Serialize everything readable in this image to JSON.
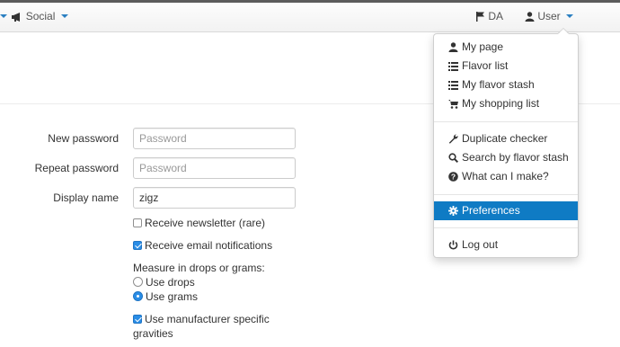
{
  "navbar": {
    "social_label": "Social",
    "language_label": "DA",
    "user_label": "User",
    "icons": {
      "social": "megaphone-icon",
      "language": "flag-icon",
      "user": "user-icon"
    }
  },
  "form": {
    "new_password": {
      "label": "New password",
      "value": "",
      "placeholder": "Password"
    },
    "repeat_password": {
      "label": "Repeat password",
      "value": "",
      "placeholder": "Password"
    },
    "display_name": {
      "label": "Display name",
      "value": "zigz",
      "placeholder": ""
    },
    "newsletter": {
      "label": "Receive newsletter (rare)",
      "checked": false
    },
    "email_notifications": {
      "label": "Receive email notifications",
      "checked": true
    },
    "measure": {
      "label": "Measure in drops or grams:",
      "options": [
        {
          "label": "Use drops",
          "selected": false
        },
        {
          "label": "Use grams",
          "selected": true
        }
      ]
    },
    "manufacturer_gravities": {
      "label_line1": "Use manufacturer specific",
      "label_line2": "gravities",
      "checked": true
    }
  },
  "user_menu": {
    "groups": [
      [
        {
          "label": "My page",
          "icon": "user-icon"
        },
        {
          "label": "Flavor list",
          "icon": "list-icon"
        },
        {
          "label": "My flavor stash",
          "icon": "list-icon"
        },
        {
          "label": "My shopping list",
          "icon": "shopping-cart-icon"
        }
      ],
      [
        {
          "label": "Duplicate checker",
          "icon": "wrench-icon"
        },
        {
          "label": "Search by flavor stash",
          "icon": "search-icon"
        },
        {
          "label": "What can I make?",
          "icon": "question-icon"
        }
      ],
      [
        {
          "label": "Preferences",
          "icon": "gear-icon",
          "active": true
        }
      ],
      [
        {
          "label": "Log out",
          "icon": "power-icon"
        }
      ]
    ]
  },
  "colors": {
    "accent": "#0f7bc4",
    "checkbox_checked": "#2a8de6",
    "caret": "#2a7fc1"
  }
}
